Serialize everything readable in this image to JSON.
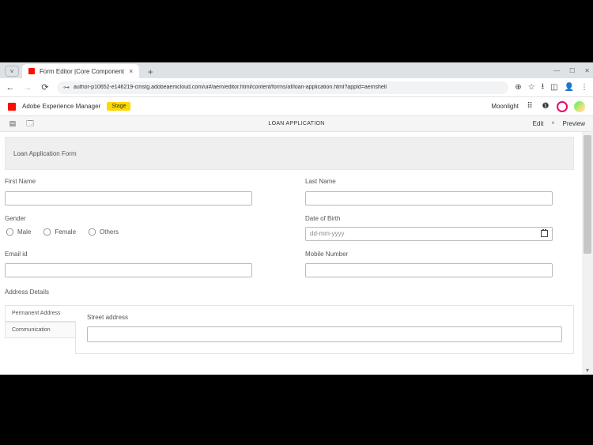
{
  "browser": {
    "tab_title": "Form Editor |Core Component",
    "url": "author-p10652-e146219-cmstg.adobeaemcloud.com/ui#/aem/editor.html/content/forms/af/loan-application.html?appId=aemshell"
  },
  "aem": {
    "brand": "Adobe Experience Manager",
    "env_pill": "Stage",
    "tenant": "Moonlight",
    "doc_title": "LOAN APPLICATION",
    "mode_label": "Edit",
    "preview_label": "Preview"
  },
  "form": {
    "title": "Loan Application Form",
    "first_name_label": "First Name",
    "last_name_label": "Last Name",
    "gender_label": "Gender",
    "gender_options": {
      "male": "Male",
      "female": "Female",
      "others": "Others"
    },
    "dob_label": "Date of Birth",
    "dob_placeholder": "dd-mm-yyyy",
    "email_label": "Email id",
    "mobile_label": "Mobile Number",
    "address_section_label": "Address Details",
    "tabs": {
      "permanent": "Permanent Address",
      "communication": "Communication"
    },
    "street_label": "Street address"
  }
}
